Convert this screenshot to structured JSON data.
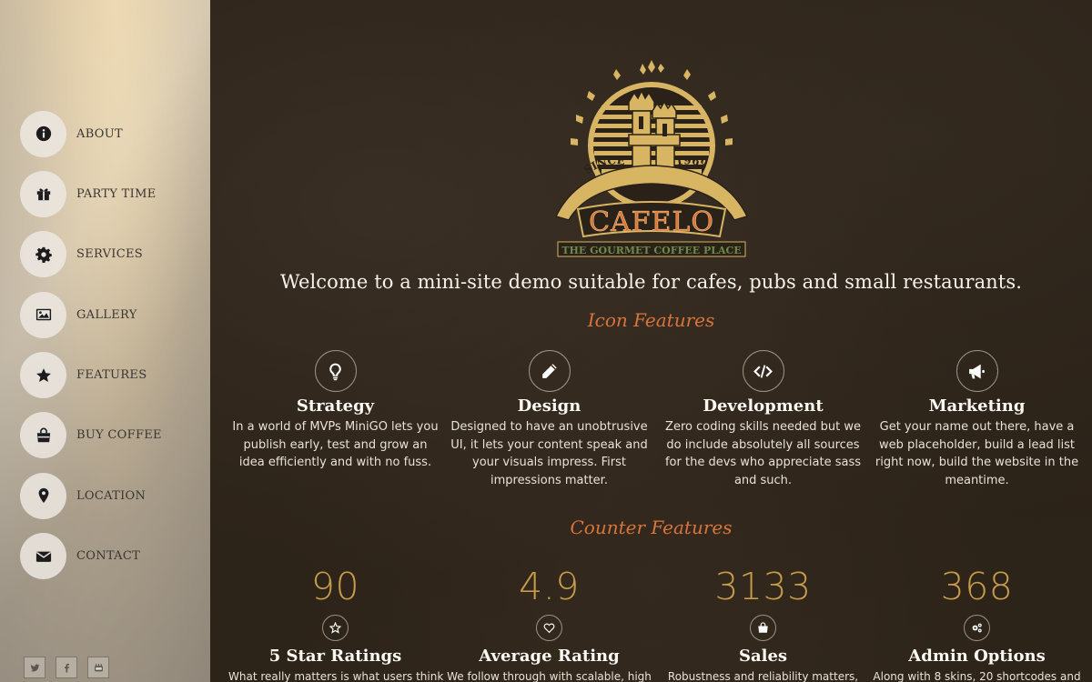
{
  "nav": {
    "items": [
      {
        "label": "ABOUT",
        "icon": "info-icon"
      },
      {
        "label": "PARTY TIME",
        "icon": "gift-icon"
      },
      {
        "label": "SERVICES",
        "icon": "gear-icon"
      },
      {
        "label": "GALLERY",
        "icon": "image-icon"
      },
      {
        "label": "FEATURES",
        "icon": "star-icon"
      },
      {
        "label": "BUY COFFEE",
        "icon": "shopping-bag-icon"
      },
      {
        "label": "LOCATION",
        "icon": "map-pin-icon"
      },
      {
        "label": "CONTACT",
        "icon": "envelope-icon"
      }
    ]
  },
  "social": [
    "twitter-icon",
    "facebook-icon",
    "youtube-icon"
  ],
  "logo": {
    "since": "SINCE",
    "year": "1969",
    "name": "CAFELO",
    "tagline": "THE GOURMET COFFEE PLACE",
    "colors": {
      "gold": "#d7b563",
      "orange": "#d9743b",
      "green": "#6f8a4a"
    }
  },
  "welcome": "Welcome to a mini-site demo suitable for cafes, pubs and small restaurants.",
  "icon_features": {
    "heading": "Icon Features",
    "items": [
      {
        "icon": "lightbulb-icon",
        "title": "Strategy",
        "text": "In a world of MVPs MiniGO lets you publish early, test and grow an idea efficiently and with no fuss."
      },
      {
        "icon": "pencil-icon",
        "title": "Design",
        "text": "Designed to have an unobtrusive UI, it lets your content speak and your visuals impress. First impressions matter."
      },
      {
        "icon": "code-icon",
        "title": "Development",
        "text": "Zero coding skills needed but we do include absolutely all sources for the devs who appreciate sass and such."
      },
      {
        "icon": "megaphone-icon",
        "title": "Marketing",
        "text": "Get your name out there, have a web placeholder, build a lead list right now, build the website in the meantime."
      }
    ]
  },
  "counter_features": {
    "heading": "Counter Features",
    "items": [
      {
        "value": "90",
        "icon": "star-outline-icon",
        "title": "5 Star Ratings",
        "text": "What really matters is what users think"
      },
      {
        "value": "4.9",
        "icon": "heart-icon",
        "title": "Average Rating",
        "text": "We follow through with scalable, high"
      },
      {
        "value": "3133",
        "icon": "shopping-bag-icon",
        "title": "Sales",
        "text": "Robustness and reliability matters,"
      },
      {
        "value": "368",
        "icon": "gears-icon",
        "title": "Admin Options",
        "text": "Along with 8 skins, 20 shortcodes and"
      }
    ]
  },
  "colors": {
    "accent": "#d9743b",
    "counter": "#c69b49",
    "background": "#2a2118"
  }
}
